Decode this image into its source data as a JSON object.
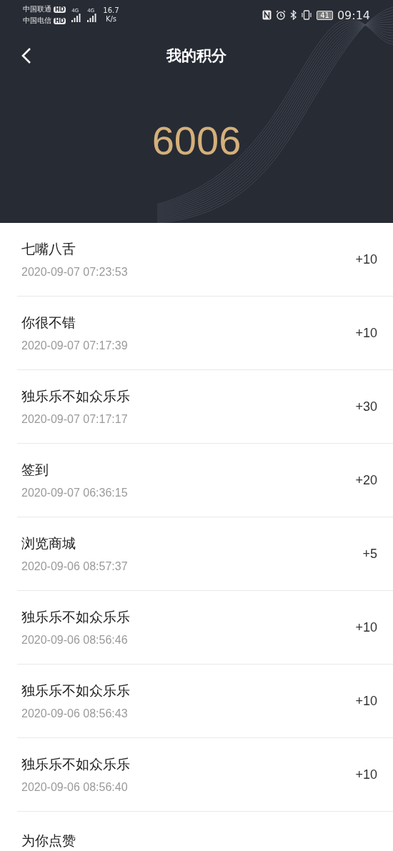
{
  "status_bar": {
    "carriers": [
      {
        "name": "中国联通",
        "badge": "HD",
        "network": "4G"
      },
      {
        "name": "中国电信",
        "badge": "HD",
        "network": "4G"
      }
    ],
    "speed": "16.7",
    "speed_unit": "K/s",
    "battery": "41",
    "time": "09:14"
  },
  "header": {
    "title": "我的积分",
    "points_total": "6006"
  },
  "records": [
    {
      "title": "七嘴八舌",
      "time": "2020-09-07 07:23:53",
      "points": "+10"
    },
    {
      "title": "你很不错",
      "time": "2020-09-07 07:17:39",
      "points": "+10"
    },
    {
      "title": "独乐乐不如众乐乐",
      "time": "2020-09-07 07:17:17",
      "points": "+30"
    },
    {
      "title": "签到",
      "time": "2020-09-07 06:36:15",
      "points": "+20"
    },
    {
      "title": "浏览商城",
      "time": "2020-09-06 08:57:37",
      "points": "+5"
    },
    {
      "title": "独乐乐不如众乐乐",
      "time": "2020-09-06 08:56:46",
      "points": "+10"
    },
    {
      "title": "独乐乐不如众乐乐",
      "time": "2020-09-06 08:56:43",
      "points": "+10"
    },
    {
      "title": "独乐乐不如众乐乐",
      "time": "2020-09-06 08:56:40",
      "points": "+10"
    },
    {
      "title": "为你点赞"
    }
  ]
}
